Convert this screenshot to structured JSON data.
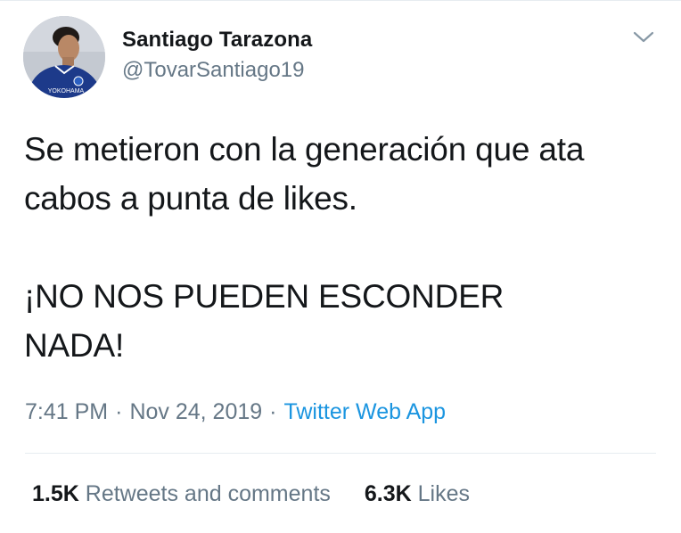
{
  "author": {
    "display_name": "Santiago Tarazona",
    "handle": "@TovarSantiago19",
    "avatar_jersey_text": "YOKOHAMA"
  },
  "tweet": {
    "line1": "Se metieron con la generación que ata",
    "line2": "cabos a punta de likes.",
    "line3": "¡NO NOS PUEDEN ESCONDER",
    "line4": "NADA!"
  },
  "meta": {
    "time": "7:41 PM",
    "separator": "·",
    "date": "Nov 24, 2019",
    "source": "Twitter Web App"
  },
  "stats": {
    "retweets_count": "1.5K",
    "retweets_label": "Retweets and comments",
    "likes_count": "6.3K",
    "likes_label": "Likes"
  },
  "icons": {
    "menu": "chevron-down-icon"
  },
  "colors": {
    "text": "#14171a",
    "secondary": "#657786",
    "link": "#1b95e0",
    "divider": "#e6ecf0"
  }
}
